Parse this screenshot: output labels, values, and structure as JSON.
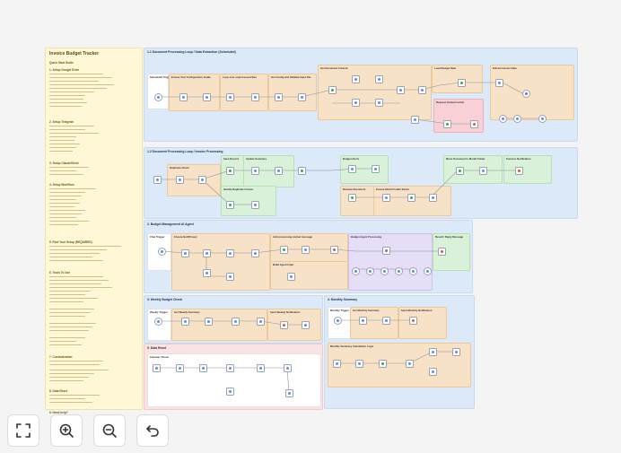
{
  "workflow": {
    "notes": {
      "title": "Invoice Budget Tracker",
      "sections": [
        "Quick Start Guide",
        "1. Setup Google Drive",
        "2. Setup Telegram",
        "3. Setup ClaudeSheet",
        "4. Setup Workflow",
        "5. Find Your Setup (REQUIRED)",
        "6. Tools To Use",
        "7. Customization",
        "8. Data Reset",
        "9. Need help?"
      ]
    },
    "sections": {
      "s1": "1.1 Document Processing Loop / Data Extraction (Scheduled)",
      "s2": "1.2 Document Processing Loop / Invoice Processing",
      "s3": "2. Budget Management AI Agent",
      "s4": "3. Weekly Budget Check",
      "s5": "4. Monthly Summary",
      "s6": "5. Data Reset"
    },
    "groups": {
      "g_sched": "Scheduled Trigger",
      "g_config": "Ensure Tool Configuration Guide",
      "g_loop": "Loop over unprocessed files",
      "g_getcfg": "Get Config and Validate Input File",
      "g_getdoc": "Get Document Content",
      "g_load": "Load Budget Data",
      "g_extract": "Extract Invoice Data",
      "g_reqmanual": "Request manual review",
      "g_dup": "Duplicate Check",
      "g_save": "Save Record",
      "g_update": "Update Summary",
      "g_alerts": "Budget Alerts",
      "g_handle": "Handle Duplicate Invoice",
      "g_rename": "Rename Document",
      "g_month": "Ensure Month Folder Exists",
      "g_move": "Move Document to Month Folder",
      "g_success": "Success Notification",
      "g_chat": "Chat Trigger",
      "g_ensure": "Ensure Bot/Privacy",
      "g_addproc": "Add processing started message",
      "g_buildagent": "Build Agent Input",
      "g_agentproc": "Budget Agent Processing",
      "g_reply": "Result / Reply Message",
      "g_weekly": "Weekly Trigger",
      "g_getweekly": "Get Weekly Summary",
      "g_sendweekly": "Send Weekly Notification",
      "g_monthly": "Monthly Trigger",
      "g_getmonthly": "Get Monthly Summary",
      "g_sendmonthly": "Send Monthly Notification",
      "g_calc": "Monthly Summary Calculation Logic",
      "g_reset": "Cleanup / Reset"
    },
    "colors": {
      "blue": "#dbe9f8",
      "orange": "#f8e2c7",
      "green": "#d9f1d8",
      "pink": "#f9d0d6",
      "yellow": "#fff7d6"
    }
  },
  "toolbar": {
    "fit_view_icon": "fit-view-icon",
    "zoom_in_icon": "zoom-in-icon",
    "zoom_out_icon": "zoom-out-icon",
    "undo_icon": "undo-icon"
  }
}
